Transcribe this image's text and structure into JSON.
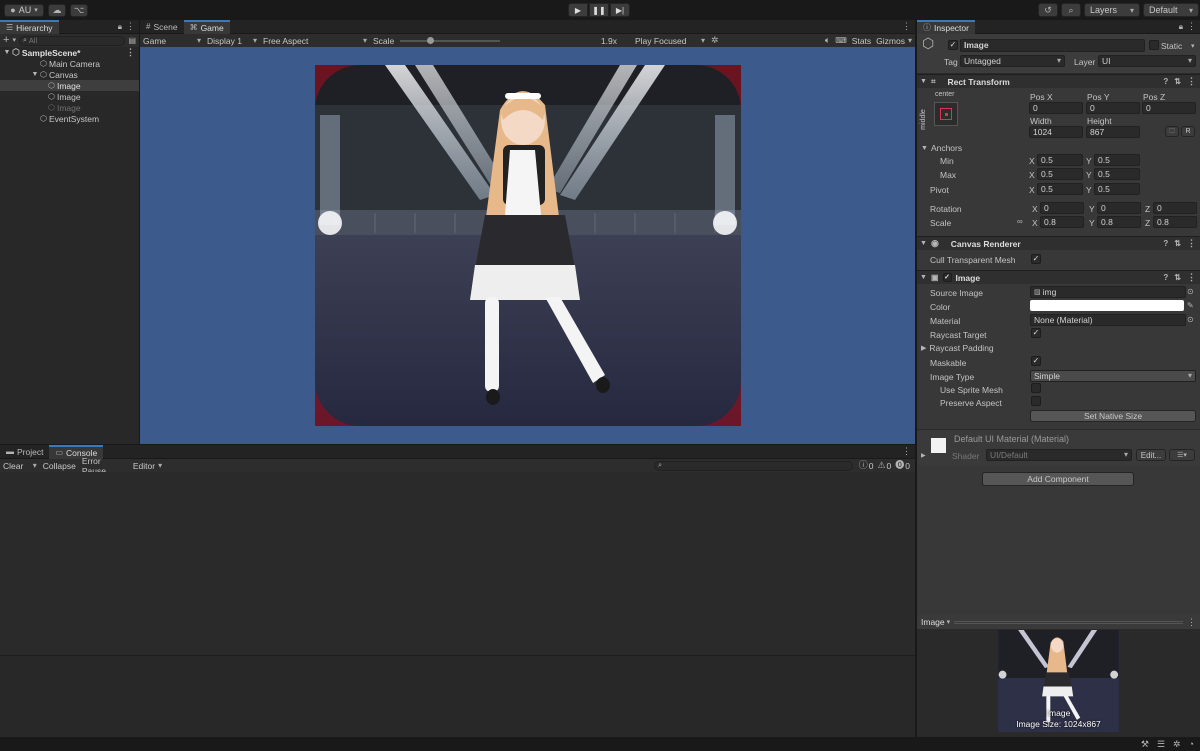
{
  "toolbar": {
    "account": "AU",
    "layers_label": "Layers",
    "layout_label": "Default"
  },
  "hierarchy": {
    "tab_label": "Hierarchy",
    "search_placeholder": "All",
    "items": [
      {
        "label": "SampleScene*"
      },
      {
        "label": "Main Camera"
      },
      {
        "label": "Canvas"
      },
      {
        "label": "Image"
      },
      {
        "label": "Image"
      },
      {
        "label": "Image"
      },
      {
        "label": "EventSystem"
      }
    ]
  },
  "game_view": {
    "tabs": [
      {
        "label": "Scene"
      },
      {
        "label": "Game"
      }
    ],
    "mode_label": "Game",
    "display_label": "Display 1",
    "aspect_label": "Free Aspect",
    "scale_label": "Scale",
    "scale_value": "1.9x",
    "scale_fraction": 0.3,
    "play_focused_label": "Play Focused",
    "stats_label": "Stats",
    "gizmos_label": "Gizmos"
  },
  "console": {
    "tabs": [
      {
        "label": "Project"
      },
      {
        "label": "Console"
      }
    ],
    "clear_label": "Clear",
    "collapse_label": "Collapse",
    "error_pause_label": "Error Pause",
    "editor_label": "Editor",
    "info_count": "0",
    "warn_count": "0",
    "error_count": "0"
  },
  "inspector": {
    "tab_label": "Inspector",
    "object_name": "Image",
    "static_label": "Static",
    "tag_label": "Tag",
    "tag_value": "Untagged",
    "layer_label": "Layer",
    "layer_value": "UI",
    "rect_transform": {
      "title": "Rect Transform",
      "anchor_h": "center",
      "anchor_v": "middle",
      "pos_x_label": "Pos X",
      "pos_y_label": "Pos Y",
      "pos_z_label": "Pos Z",
      "pos_x": "0",
      "pos_y": "0",
      "pos_z": "0",
      "width_label": "Width",
      "height_label": "Height",
      "width": "1024",
      "height": "867",
      "r_button": "R",
      "anchors_label": "Anchors",
      "min_label": "Min",
      "max_label": "Max",
      "pivot_label": "Pivot",
      "x_label": "X",
      "y_label": "Y",
      "z_label": "Z",
      "min_x": "0.5",
      "min_y": "0.5",
      "max_x": "0.5",
      "max_y": "0.5",
      "pivot_x": "0.5",
      "pivot_y": "0.5",
      "rotation_label": "Rotation",
      "rot_x": "0",
      "rot_y": "0",
      "rot_z": "0",
      "scale_label": "Scale",
      "scale_x": "0.8",
      "scale_y": "0.8",
      "scale_z": "0.8"
    },
    "canvas_renderer": {
      "title": "Canvas Renderer",
      "cull_label": "Cull Transparent Mesh"
    },
    "image": {
      "title": "Image",
      "source_label": "Source Image",
      "source_value": "img",
      "color_label": "Color",
      "color_value": "#ffffff",
      "material_label": "Material",
      "material_value": "None (Material)",
      "raycast_target_label": "Raycast Target",
      "raycast_padding_label": "Raycast Padding",
      "maskable_label": "Maskable",
      "image_type_label": "Image Type",
      "image_type_value": "Simple",
      "use_sprite_mesh_label": "Use Sprite Mesh",
      "preserve_aspect_label": "Preserve Aspect",
      "native_size_button": "Set Native Size"
    },
    "material": {
      "title": "Default UI Material (Material)",
      "shader_label": "Shader",
      "shader_value": "UI/Default",
      "edit_button": "Edit..."
    },
    "add_component": "Add Component",
    "preview": {
      "dropdown_label": "Image",
      "caption_name": "Image",
      "caption_size": "Image Size: 1024x867"
    }
  },
  "colors": {
    "accent": "#3a79bb",
    "game_bg": "#3d5a8c",
    "selection": "#3a3a3a"
  }
}
